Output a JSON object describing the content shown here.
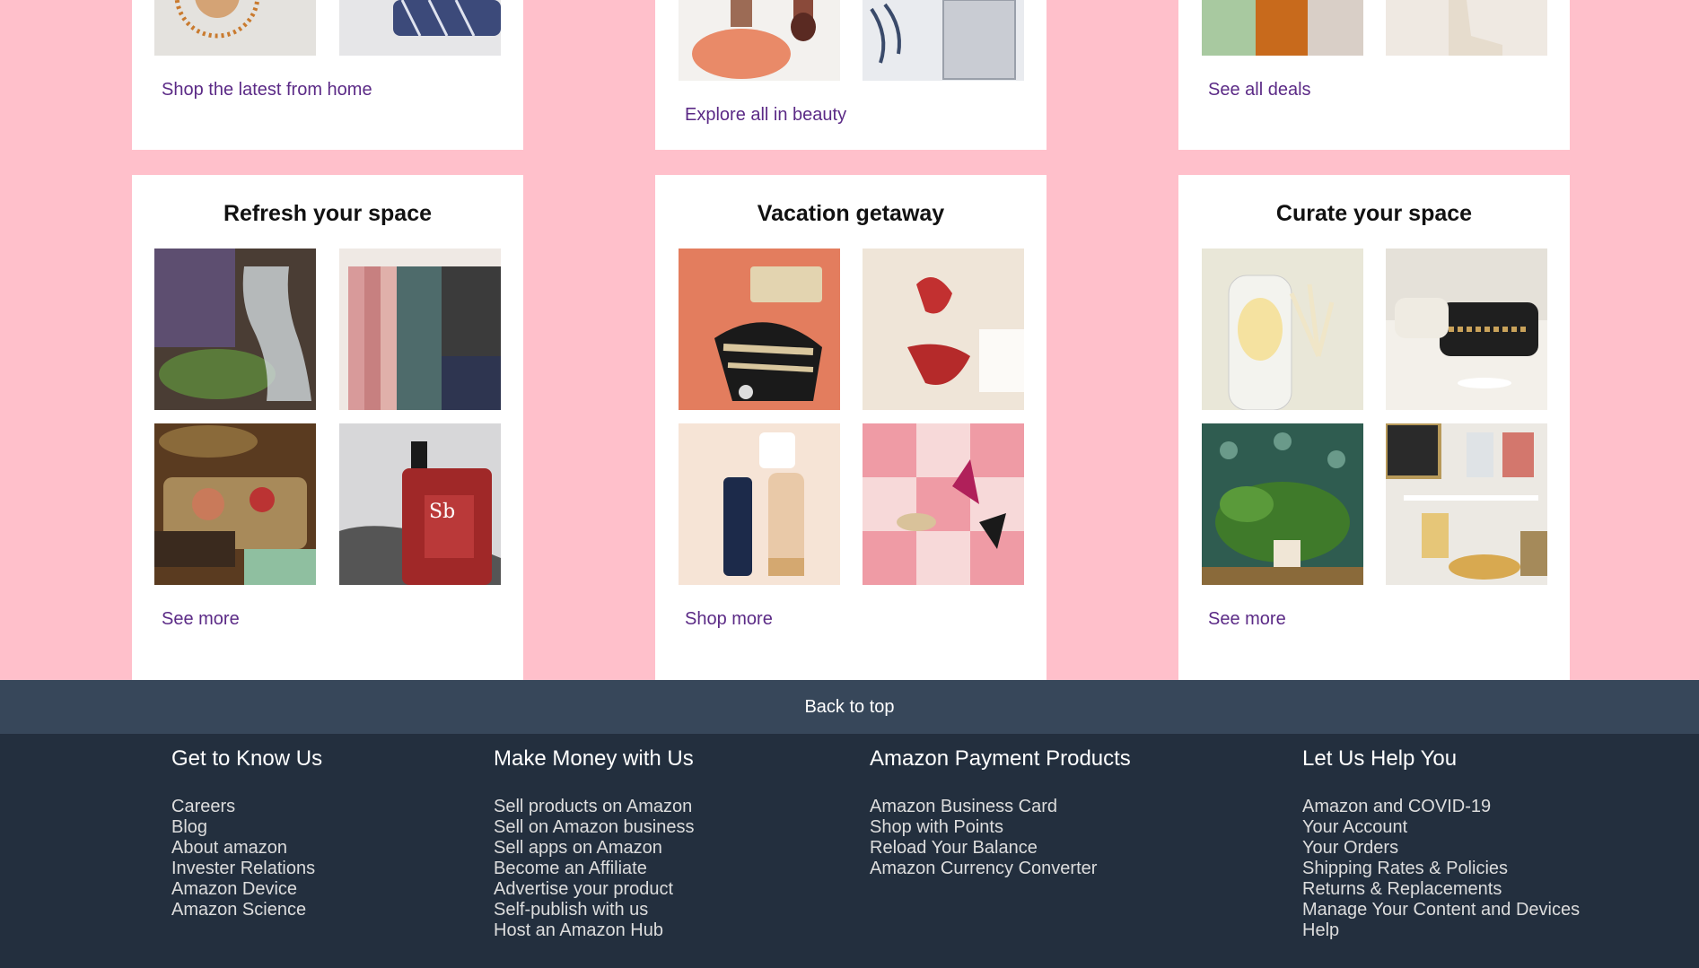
{
  "top_cards": [
    {
      "link": "Shop the latest from home"
    },
    {
      "link": "Explore all in beauty"
    },
    {
      "link": "See all deals"
    }
  ],
  "cards": [
    {
      "title": "Refresh your space",
      "link": "See more"
    },
    {
      "title": "Vacation getaway",
      "link": "Shop more"
    },
    {
      "title": "Curate your space",
      "link": "See more"
    }
  ],
  "back_to_top": "Back to top",
  "footer": {
    "columns": [
      {
        "heading": "Get to Know Us",
        "links": [
          "Careers",
          "Blog",
          "About amazon",
          "Invester Relations",
          "Amazon Device",
          "Amazon Science"
        ]
      },
      {
        "heading": "Make Money with Us",
        "links": [
          "Sell products on Amazon",
          "Sell on Amazon business",
          "Sell apps on Amazon",
          "Become an Affiliate",
          "Advertise your product",
          "Self-publish with us",
          "Host an Amazon Hub"
        ]
      },
      {
        "heading": "Amazon Payment Products",
        "links": [
          "Amazon Business Card",
          "Shop with Points",
          "Reload Your Balance",
          "Amazon Currency Converter"
        ]
      },
      {
        "heading": "Let Us Help You",
        "links": [
          "Amazon and COVID-19",
          "Your Account",
          "Your Orders",
          "Shipping Rates & Policies",
          "Returns & Replacements",
          "Manage Your Content and Devices",
          "Help"
        ]
      }
    ]
  },
  "colors": {
    "page_bg": "#ffc0cb",
    "footer_bg": "#232f3e",
    "back_to_top_bg": "#37475a",
    "link": "#5b2a86"
  }
}
